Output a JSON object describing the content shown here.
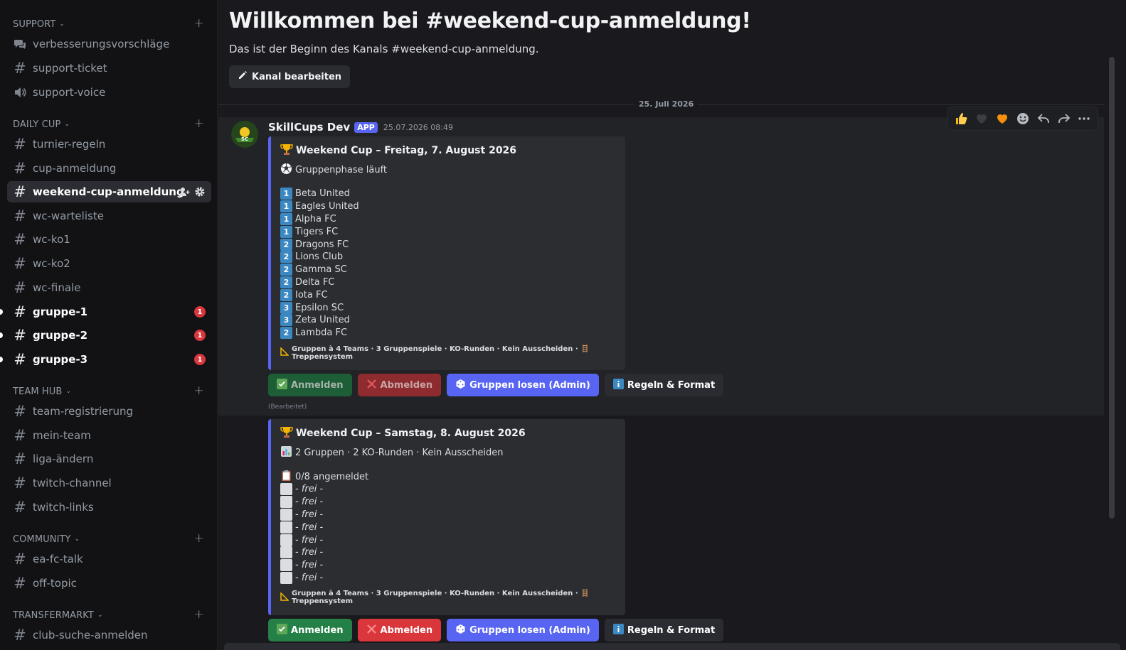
{
  "sidebar": {
    "categories": {
      "support": "SUPPORT",
      "daily_cup": "DAILY CUP",
      "team_hub": "TEAM HUB",
      "community": "COMMUNITY",
      "transfermarkt": "TRANSFERMARKT"
    },
    "channels": {
      "verbesserungsvorschlaege": "verbesserungsvorschläge",
      "support_ticket": "support-ticket",
      "support_voice": "support-voice",
      "turnier_regeln": "turnier-regeln",
      "cup_anmeldung": "cup-anmeldung",
      "weekend_cup_anmeldung": "weekend-cup-anmeldung",
      "wc_warteliste": "wc-warteliste",
      "wc_ko1": "wc-ko1",
      "wc_ko2": "wc-ko2",
      "wc_finale": "wc-finale",
      "gruppe_1": "gruppe-1",
      "gruppe_2": "gruppe-2",
      "gruppe_3": "gruppe-3",
      "team_registrierung": "team-registrierung",
      "mein_team": "mein-team",
      "liga_aendern": "liga-ändern",
      "twitch_channel": "twitch-channel",
      "twitch_links": "twitch-links",
      "ea_fc_talk": "ea-fc-talk",
      "off_topic": "off-topic",
      "club_suche": "club-suche-anmelden"
    },
    "badges": {
      "gruppe_1": "1",
      "gruppe_2": "1",
      "gruppe_3": "1"
    }
  },
  "main": {
    "welcome_title": "Willkommen bei #weekend-cup-anmeldung!",
    "welcome_sub": "Das ist der Beginn des Kanals #weekend-cup-anmeldung.",
    "edit_button": "Kanal bearbeiten",
    "date_divider": "25. Juli 2026",
    "message": {
      "author": "SkillCups Dev",
      "app_tag": "APP",
      "timestamp": "25.07.2026 08:49",
      "edited": "(Bearbeitet)"
    },
    "embed1": {
      "title": "Weekend Cup – Freitag, 7. August 2026",
      "desc": "Gruppenphase läuft",
      "teams": [
        {
          "group": "1",
          "name": "Beta United"
        },
        {
          "group": "1",
          "name": "Eagles United"
        },
        {
          "group": "1",
          "name": "Alpha FC"
        },
        {
          "group": "1",
          "name": "Tigers FC"
        },
        {
          "group": "2",
          "name": "Dragons FC"
        },
        {
          "group": "2",
          "name": "Lions Club"
        },
        {
          "group": "2",
          "name": "Gamma SC"
        },
        {
          "group": "2",
          "name": "Delta FC"
        },
        {
          "group": "2",
          "name": "Iota FC"
        },
        {
          "group": "3",
          "name": "Epsilon SC"
        },
        {
          "group": "3",
          "name": "Zeta United"
        },
        {
          "group": "2",
          "name": "Lambda FC"
        }
      ],
      "footer": "Gruppen à 4 Teams · 3 Gruppenspiele · KO-Runden · Kein Ausscheiden · 🪜 Treppensystem"
    },
    "embed2": {
      "title": "Weekend Cup – Samstag, 8. August 2026",
      "desc": "2 Gruppen · 2 KO-Runden · Kein Ausscheiden",
      "count": "0/8 angemeldet",
      "slot_label": "- frei -",
      "footer": "Gruppen à 4 Teams · 3 Gruppenspiele · KO-Runden · Kein Ausscheiden · 🪜 Treppensystem"
    },
    "buttons": {
      "anmelden": "Anmelden",
      "abmelden": "Abmelden",
      "gruppen_losen": "Gruppen losen (Admin)",
      "regeln": "Regeln & Format"
    },
    "colors": {
      "blurple": "#5865f2",
      "green": "#248046",
      "red": "#da373c",
      "keycap": "#3b88c3"
    }
  }
}
